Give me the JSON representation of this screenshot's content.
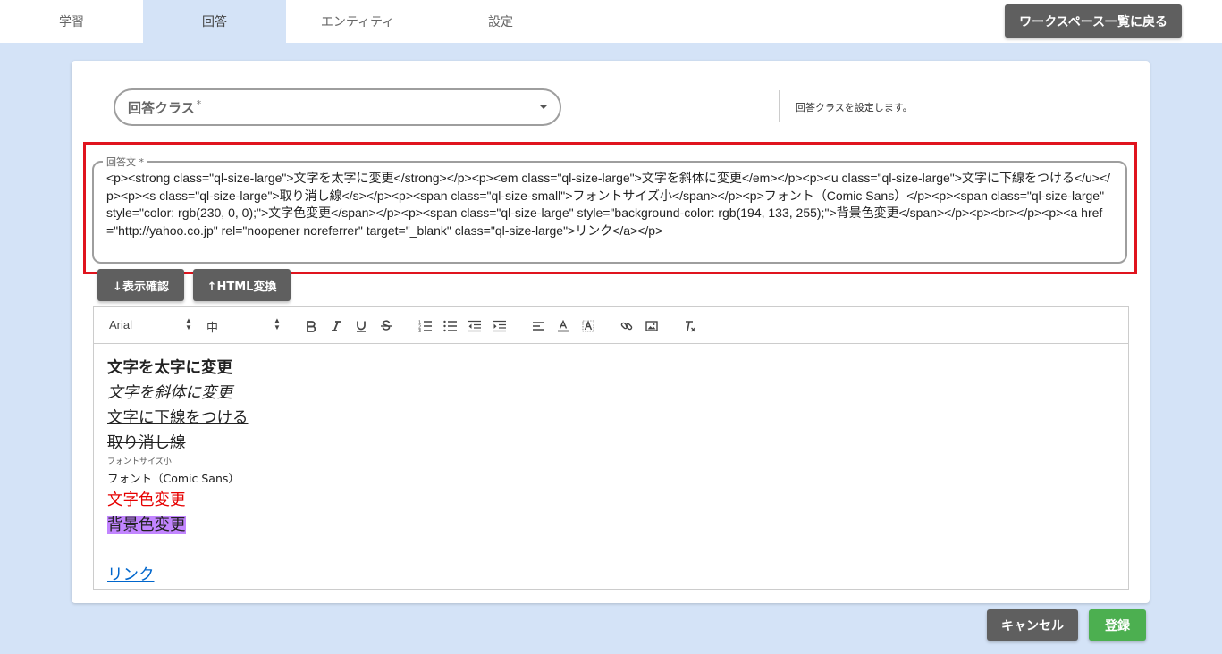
{
  "tabs": [
    {
      "label": "学習",
      "active": false
    },
    {
      "label": "回答",
      "active": true
    },
    {
      "label": "エンティティ",
      "active": false
    },
    {
      "label": "設定",
      "active": false
    }
  ],
  "workspace_button": "ワークスペース一覧に戻る",
  "answer_class": {
    "label": "回答クラス",
    "required_mark": "*",
    "help": "回答クラスを設定します。"
  },
  "answer_text": {
    "legend": "回答文 *",
    "value": "<p><strong class=\"ql-size-large\">文字を太字に変更</strong></p><p><em class=\"ql-size-large\">文字を斜体に変更</em></p><p><u class=\"ql-size-large\">文字に下線をつける</u></p><p><s class=\"ql-size-large\">取り消し線</s></p><p><span class=\"ql-size-small\">フォントサイズ小</span></p><p>フォント（Comic Sans）</p><p><span class=\"ql-size-large\" style=\"color: rgb(230, 0, 0);\">文字色変更</span></p><p><span class=\"ql-size-large\" style=\"background-color: rgb(194, 133, 255);\">背景色変更</span></p><p><br></p><p><a href=\"http://yahoo.co.jp\" rel=\"noopener noreferrer\" target=\"_blank\" class=\"ql-size-large\">リンク</a></p>"
  },
  "actions": {
    "preview": "↓表示確認",
    "to_html": "↑HTML変換"
  },
  "toolbar": {
    "font": "Arial",
    "size": "中",
    "buttons": [
      "bold-icon",
      "italic-icon",
      "underline-icon",
      "strike-icon",
      "ordered-list-icon",
      "bullet-list-icon",
      "outdent-icon",
      "indent-icon",
      "align-icon",
      "text-color-icon",
      "background-color-icon",
      "link-icon",
      "image-icon",
      "clear-format-icon"
    ]
  },
  "editor": {
    "bold": "文字を太字に変更",
    "italic": "文字を斜体に変更",
    "underline": "文字に下線をつける",
    "strike": "取り消し線",
    "small": "フォントサイズ小",
    "font": "フォント（Comic Sans）",
    "color": "文字色変更",
    "background": "背景色変更",
    "link": "リンク",
    "colors": {
      "text_color": "#e60000",
      "background_color": "#c285ff"
    }
  },
  "footer": {
    "cancel": "キャンセル",
    "save": "登録"
  }
}
